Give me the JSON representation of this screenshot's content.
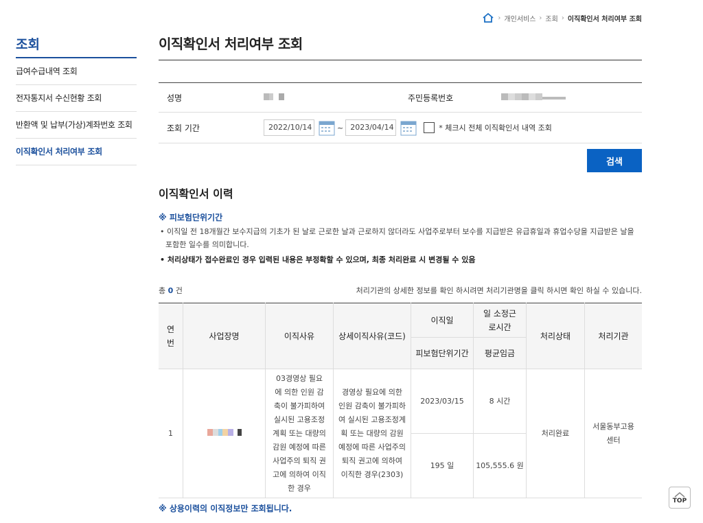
{
  "breadcrumb": {
    "items": [
      "개인서비스",
      "조회"
    ],
    "current": "이직확인서 처리여부 조회"
  },
  "sidebar": {
    "title": "조회",
    "items": [
      {
        "label": "급여수급내역 조회"
      },
      {
        "label": "전자통지서 수신현황 조회"
      },
      {
        "label": "반환액 및 납부(가상)계좌번호 조회"
      },
      {
        "label": "이직확인서 처리여부 조회"
      }
    ]
  },
  "page": {
    "title": "이직확인서 처리여부 조회"
  },
  "form": {
    "name_label": "성명",
    "rrn_label": "주민등록번호",
    "period_label": "조회 기간",
    "date_from": "2022/10/14",
    "date_to": "2023/04/14",
    "tilde": "~",
    "all_check_label": "* 체크시 전체 이직확인서 내역 조회",
    "search_button": "검색"
  },
  "history": {
    "title": "이직확인서 이력",
    "note_title": "※ 피보험단위기간",
    "bullets": [
      "• 이직일 전 18개월간 보수지급의 기초가 된 날로 근로한 날과 근로하지 않더라도 사업주로부터 보수를 지급받은 유급휴일과 휴업수당을 지급받은 날을 포함한 일수를 의미합니다.",
      "• 처리상태가 접수완료인 경우 입력된 내용은 부정확할 수 있으며, 최종 처리완료 시 변경될 수 있음"
    ],
    "total_prefix": "총",
    "total_count": "0",
    "total_suffix": "건",
    "help_text": "처리기관의 상세한 정보를 확인 하시려면 처리기관명을 클릭 하시면 확인 하실 수 있습니다."
  },
  "table": {
    "headers": {
      "no": "연번",
      "company": "사업장명",
      "reason": "이직사유",
      "detail": "상세이직사유(코드)",
      "sep_date": "이직일",
      "hours": "일 소정근로시간",
      "status": "처리상태",
      "agency": "처리기관",
      "insured_period": "피보험단위기간",
      "avg_wage": "평균임금"
    },
    "rows": [
      {
        "no": "1",
        "reason": "03경영상 필요에 의한 인원 감축이 불가피하여 실시된 고용조정계획 또는 대량의 감원 예정에 따른 사업주의 퇴직 권고에 의하여 이직한 경우",
        "detail": "경영상 필요에 의한 인원 감축이 불가피하여 실시된 고용조정계획 또는 대량의 감원 예정에 따른 사업주의 퇴직 권고에 의하여 이직한 경우(2303)",
        "sep_date": "2023/03/15",
        "hours": "8 시간",
        "insured_period": "195 일",
        "avg_wage": "105,555.6 원",
        "status": "처리완료",
        "agency": "서울동부고용센터"
      }
    ]
  },
  "footnote": "※ 상용이력의 이직정보만 조회됩니다.",
  "top_button": "TOP",
  "colors": {
    "accent": "#1a4f9c",
    "button": "#0a62c3"
  }
}
